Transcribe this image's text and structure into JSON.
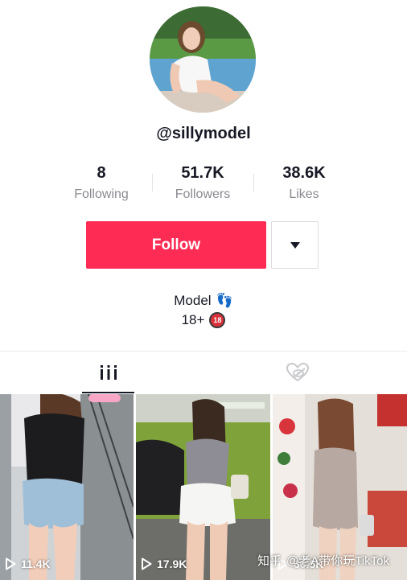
{
  "profile": {
    "username": "@sillymodel",
    "bio_line1": "Model",
    "bio_line1_emoji": "👣",
    "bio_line2": "18+",
    "age_badge": "18"
  },
  "stats": [
    {
      "value": "8",
      "label": "Following"
    },
    {
      "value": "51.7K",
      "label": "Followers"
    },
    {
      "value": "38.6K",
      "label": "Likes"
    }
  ],
  "actions": {
    "follow_label": "Follow",
    "accent_color": "#fe2c55"
  },
  "tabs": [
    {
      "icon": "videos-grid-icon",
      "active": true
    },
    {
      "icon": "liked-videos-hidden-icon",
      "active": false
    }
  ],
  "videos": [
    {
      "views": "11.4K"
    },
    {
      "views": "17.9K"
    },
    {
      "views": "36.5K"
    }
  ],
  "watermark": {
    "site": "知乎",
    "text": "@老A带你玩TikTok"
  }
}
